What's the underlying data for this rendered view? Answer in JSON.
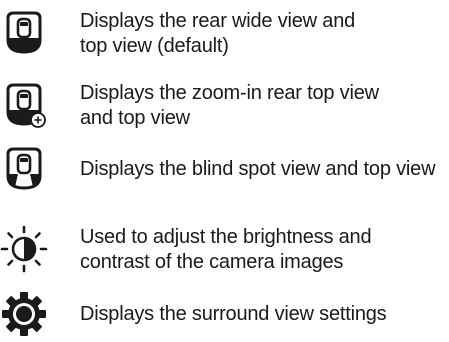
{
  "items": [
    {
      "icon": "rear-wide-top-view-icon",
      "lines": [
        "Displays the rear wide view and",
        "top view (default)"
      ]
    },
    {
      "icon": "zoom-rear-top-view-icon",
      "lines": [
        "Displays the zoom-in rear top view",
        "and top view"
      ]
    },
    {
      "icon": "blind-spot-view-icon",
      "lines": [
        "Displays the blind spot view and top view"
      ]
    },
    {
      "icon": "brightness-contrast-icon",
      "lines": [
        "Used to adjust the brightness and",
        "contrast of the camera images"
      ]
    },
    {
      "icon": "settings-gear-icon",
      "lines": [
        "Displays the surround view settings"
      ]
    }
  ],
  "colors": {
    "icon": "#1a1a1a",
    "text": "#1a1a1a"
  }
}
